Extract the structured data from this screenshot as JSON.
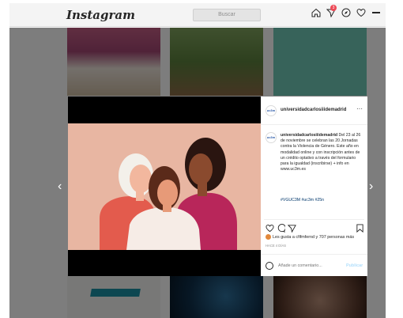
{
  "header": {
    "logo": "Instagram",
    "search_placeholder": "Buscar",
    "notification_count": "3"
  },
  "post": {
    "username": "universidadcarlosiiidemadrid",
    "avatar_text": "uc3m",
    "more": "···",
    "caption": "Del 23 al 26 de noviembre se celebran las 20 Jornadas contra la Violencia de Género. Este año en modalidad online y con inscripción antes de un crédito optativo a través del formulario para la igualdad (inscribirse) + info en www.uc3m.es",
    "hashtags": "#VGUC3M #uc3m #25n",
    "likes_text": "Les gusta a cfifmfernd y 707 personas más",
    "timestamp": "HACE 4 DÍAS",
    "comment_placeholder": "Añade un comentario...",
    "publish_label": "Publicar"
  },
  "navigation": {
    "prev": "‹",
    "next": "›"
  },
  "colors": {
    "accent_link": "#00376b",
    "publish_disabled": "#b2dffc",
    "badge": "#ed4956"
  },
  "icons": [
    "home-icon",
    "direct-icon",
    "explore-icon",
    "heart-icon",
    "avatar-icon",
    "like-icon",
    "comment-icon",
    "share-icon",
    "save-icon",
    "emoji-icon",
    "more-icon"
  ]
}
